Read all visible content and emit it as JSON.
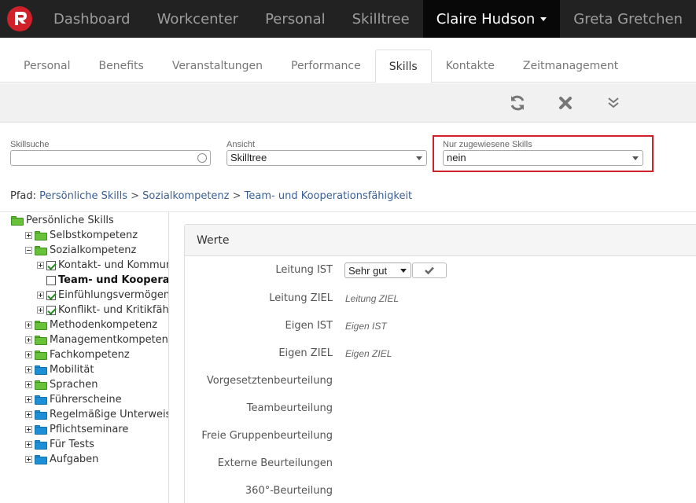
{
  "topnav": {
    "items": [
      {
        "label": "Dashboard"
      },
      {
        "label": "Workcenter"
      },
      {
        "label": "Personal"
      },
      {
        "label": "Skilltree"
      },
      {
        "label": "Claire Hudson"
      },
      {
        "label": "Greta Gretchen"
      }
    ],
    "active_index": 4
  },
  "tabs": [
    {
      "label": "Personal"
    },
    {
      "label": "Benefits"
    },
    {
      "label": "Veranstaltungen"
    },
    {
      "label": "Performance"
    },
    {
      "label": "Skills"
    },
    {
      "label": "Kontakte"
    },
    {
      "label": "Zeitmanagement"
    }
  ],
  "toolbar": {
    "icons": [
      "refresh-icon",
      "close-icon",
      "double-chevron-down-icon"
    ]
  },
  "filters": {
    "search": {
      "label": "Skillsuche",
      "value": ""
    },
    "view": {
      "label": "Ansicht",
      "value": "Skilltree"
    },
    "assigned": {
      "label": "Nur zugewiesene Skills",
      "value": "nein"
    }
  },
  "path": {
    "label": "Pfad:",
    "crumbs": [
      "Persönliche Skills",
      "Sozialkompetenz",
      "Team- und Kooperationsfähigkeit"
    ],
    "separator": ">"
  },
  "tree": {
    "root": "Persönliche Skills",
    "items": [
      {
        "label": "Selbstkompetenz"
      },
      {
        "label": "Sozialkompetenz"
      },
      {
        "label": "Kontakt- und Kommun"
      },
      {
        "label": "Team- und Kooperati"
      },
      {
        "label": "Einfühlungsvermögen"
      },
      {
        "label": "Konflikt- und Kritikfäh"
      },
      {
        "label": "Methodenkompetenz"
      },
      {
        "label": "Managementkompetenz"
      },
      {
        "label": "Fachkompetenz"
      },
      {
        "label": "Mobilität"
      },
      {
        "label": "Sprachen"
      },
      {
        "label": "Führerscheine"
      },
      {
        "label": "Regelmäßige Unterweisu"
      },
      {
        "label": "Pflichtseminare"
      },
      {
        "label": "Für Tests"
      },
      {
        "label": "Aufgaben"
      }
    ]
  },
  "panel": {
    "title": "Werte",
    "rows": [
      {
        "label": "Leitung IST",
        "select_value": "Sehr gut"
      },
      {
        "label": "Leitung ZIEL",
        "value": "Leitung ZIEL"
      },
      {
        "label": "Eigen IST",
        "value": "Eigen IST"
      },
      {
        "label": "Eigen ZIEL",
        "value": "Eigen ZIEL"
      },
      {
        "label": "Vorgesetztenbeurteilung",
        "value": ""
      },
      {
        "label": "Teambeurteilung",
        "value": ""
      },
      {
        "label": "Freie Gruppenbeurteilung",
        "value": ""
      },
      {
        "label": "Externe Beurteilungen",
        "value": ""
      },
      {
        "label": "360°-Beurteilung",
        "value": ""
      }
    ]
  },
  "colors": {
    "navbar": "#222222",
    "highlight": "#d0202a",
    "link": "#3a5f96",
    "folder_green": "#67c23a",
    "folder_blue": "#1d8fd6"
  }
}
